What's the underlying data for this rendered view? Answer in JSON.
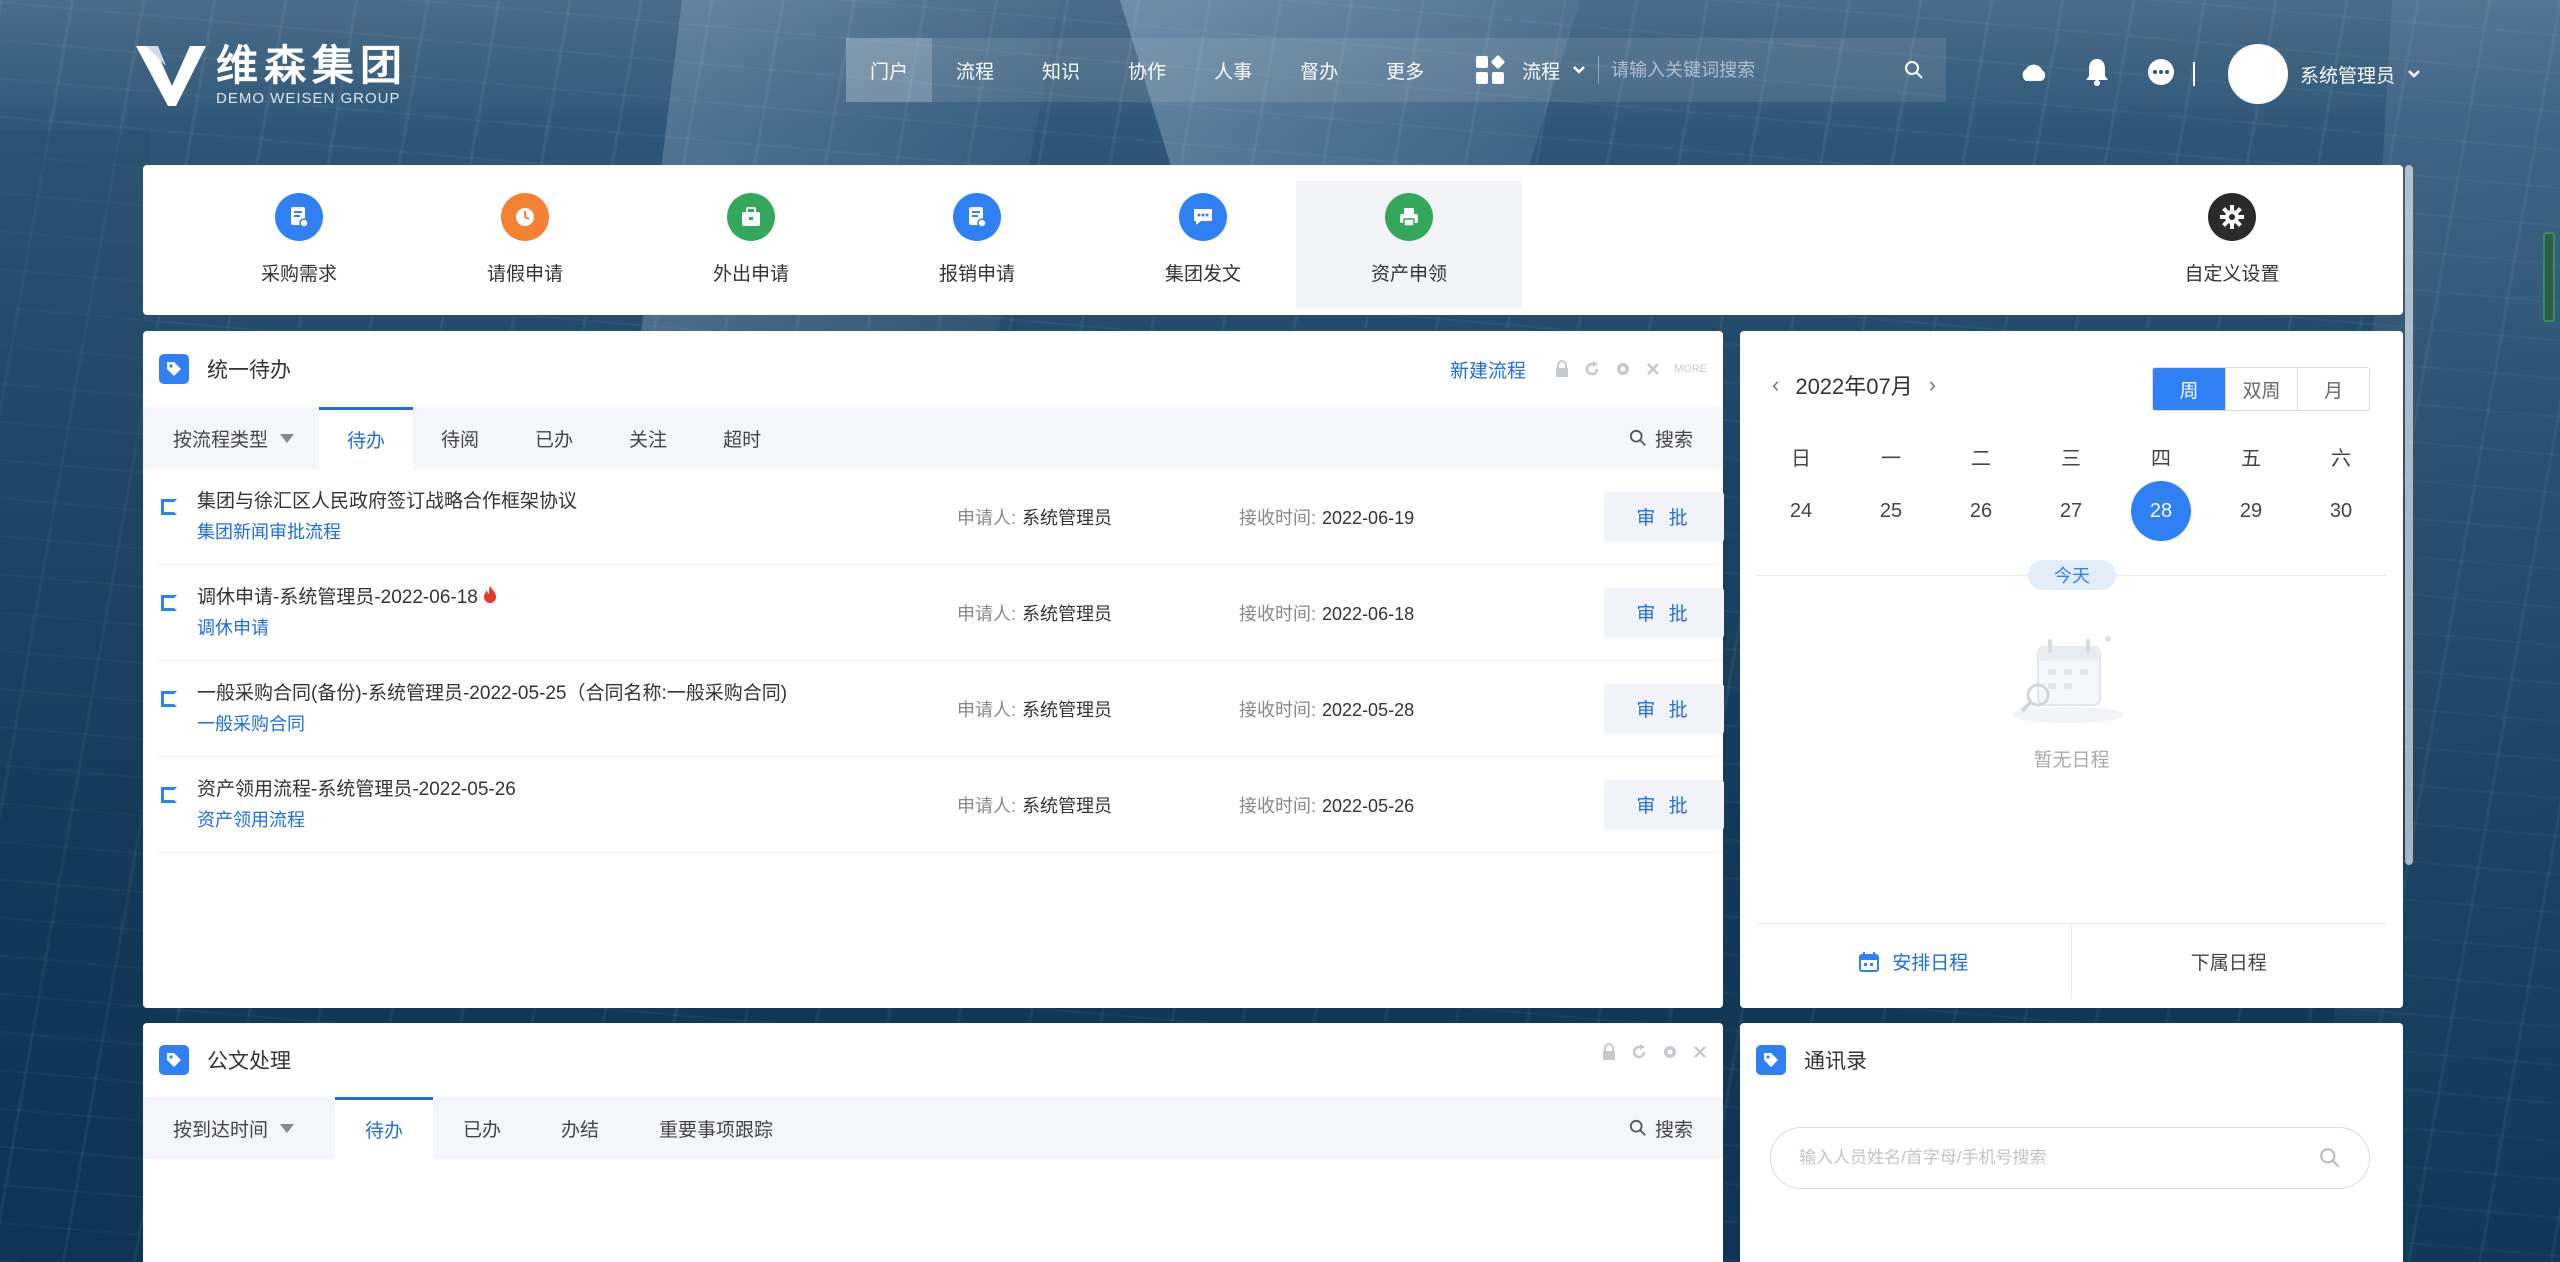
{
  "brand": {
    "name_cn": "维森集团",
    "name_en": "DEMO WEISEN GROUP"
  },
  "nav": {
    "items": [
      "门户",
      "流程",
      "知识",
      "协作",
      "人事",
      "督办",
      "更多"
    ],
    "active_index": 0,
    "select_label": "流程",
    "search_placeholder": "请输入关键词搜索"
  },
  "user": {
    "name": "系统管理员"
  },
  "quick_links": [
    {
      "label": "采购需求",
      "color": "#2f7ff5",
      "icon": "document-icon"
    },
    {
      "label": "请假申请",
      "color": "#f58233",
      "icon": "clock-icon"
    },
    {
      "label": "外出申请",
      "color": "#33a85a",
      "icon": "briefcase-icon"
    },
    {
      "label": "报销申请",
      "color": "#2f7ff5",
      "icon": "document-icon"
    },
    {
      "label": "集团发文",
      "color": "#2f7ff5",
      "icon": "chat-icon"
    },
    {
      "label": "资产申领",
      "color": "#33a85a",
      "icon": "printer-icon"
    }
  ],
  "custom_settings": {
    "label": "自定义设置",
    "icon": "gear-icon"
  },
  "todo": {
    "title": "统一待办",
    "new_flow": "新建流程",
    "more": "MORE",
    "filter": "按流程类型",
    "tabs": [
      "待办",
      "待阅",
      "已办",
      "关注",
      "超时"
    ],
    "active_tab": 0,
    "search": "搜索",
    "applicant_label": "申请人:",
    "receive_label": "接收时间:",
    "approve_label": "审 批",
    "rows": [
      {
        "title": "集团与徐汇区人民政府签订战略合作框架协议",
        "flow": "集团新闻审批流程",
        "applicant": "系统管理员",
        "time": "2022-06-19",
        "hot": false
      },
      {
        "title": "调休申请-系统管理员-2022-06-18",
        "flow": "调休申请",
        "applicant": "系统管理员",
        "time": "2022-06-18",
        "hot": true
      },
      {
        "title": "一般采购合同(备份)-系统管理员-2022-05-25（合同名称:一般采购合同)",
        "flow": "一般采购合同",
        "applicant": "系统管理员",
        "time": "2022-05-28",
        "hot": false
      },
      {
        "title": "资产领用流程-系统管理员-2022-05-26",
        "flow": "资产领用流程",
        "applicant": "系统管理员",
        "time": "2022-05-26",
        "hot": false
      }
    ]
  },
  "calendar": {
    "month": "2022年07月",
    "views": [
      "周",
      "双周",
      "月"
    ],
    "active_view": 0,
    "weekdays": [
      "日",
      "一",
      "二",
      "三",
      "四",
      "五",
      "六"
    ],
    "days": [
      "24",
      "25",
      "26",
      "27",
      "28",
      "29",
      "30"
    ],
    "today_index": 4,
    "today_label": "今天",
    "empty": "暂无日程",
    "footer_left": "安排日程",
    "footer_right": "下属日程"
  },
  "docs": {
    "title": "公文处理",
    "filter": "按到达时间",
    "tabs": [
      "待办",
      "已办",
      "办结",
      "重要事项跟踪"
    ],
    "active_tab": 0,
    "search": "搜索"
  },
  "contacts": {
    "title": "通讯录",
    "search_placeholder": "输入人员姓名/首字母/手机号搜索"
  }
}
